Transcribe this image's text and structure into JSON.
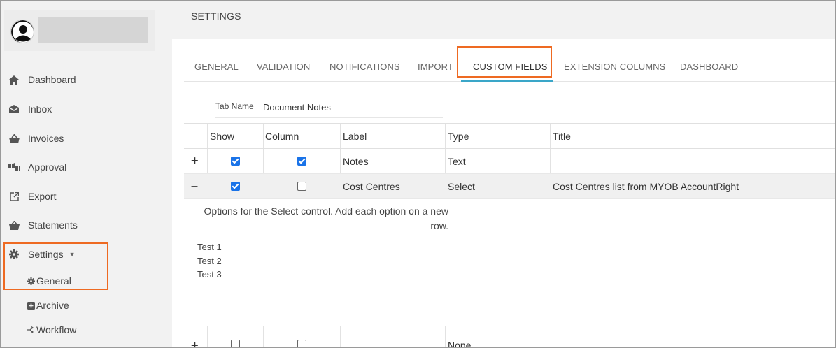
{
  "sidebar": {
    "items": [
      {
        "label": "Dashboard",
        "icon": "home-icon"
      },
      {
        "label": "Inbox",
        "icon": "inbox-icon"
      },
      {
        "label": "Invoices",
        "icon": "basket-icon"
      },
      {
        "label": "Approval",
        "icon": "approval-icon"
      },
      {
        "label": "Export",
        "icon": "export-icon"
      },
      {
        "label": "Statements",
        "icon": "basket-icon"
      },
      {
        "label": "Settings",
        "icon": "gear-icon"
      }
    ],
    "subitems": [
      {
        "label": "General",
        "icon": "gear-icon"
      },
      {
        "label": "Archive",
        "icon": "archive-icon"
      },
      {
        "label": "Workflow",
        "icon": "workflow-icon"
      }
    ]
  },
  "header": {
    "title": "SETTINGS"
  },
  "tabs": [
    {
      "label": "GENERAL"
    },
    {
      "label": "VALIDATION"
    },
    {
      "label": "NOTIFICATIONS"
    },
    {
      "label": "IMPORT"
    },
    {
      "label": "CUSTOM FIELDS",
      "active": true
    },
    {
      "label": "EXTENSION COLUMNS"
    },
    {
      "label": "DASHBOARD"
    }
  ],
  "tab_name": {
    "label": "Tab Name",
    "value": "Document Notes"
  },
  "grid": {
    "columns": [
      "Show",
      "Column",
      "Label",
      "Type",
      "Title"
    ],
    "rows": [
      {
        "expander": "+",
        "show": true,
        "column": true,
        "label": "Notes",
        "type": "Text",
        "title": ""
      },
      {
        "expander": "–",
        "show": true,
        "column": false,
        "label": "Cost Centres",
        "type": "Select",
        "title": "Cost Centres list from MYOB AccountRight"
      },
      {
        "expander": "+",
        "show": false,
        "column": false,
        "label": "",
        "type": "None",
        "title": ""
      }
    ]
  },
  "options": {
    "help_line1": "Options for the Select control. Add each option on a new",
    "help_line2": "row.",
    "values": [
      "Test 1",
      "Test 2",
      "Test 3"
    ]
  },
  "colors": {
    "highlight": "#ee6a22",
    "tab_underline": "#3aa6c8",
    "checkbox": "#1a73e8"
  }
}
